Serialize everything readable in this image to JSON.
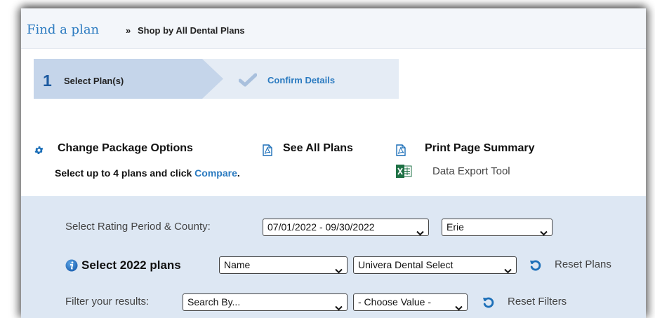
{
  "breadcrumb": {
    "link": "Find a plan",
    "separator": "»",
    "current": "Shop by All Dental Plans"
  },
  "steps": {
    "step1_number": "1",
    "step1_label": "Select Plan(s)",
    "step2_label": "Confirm Details"
  },
  "actions": {
    "change_package": "Change Package Options",
    "see_all_plans": "See All Plans",
    "print_summary": "Print Page Summary",
    "select_text": "Select up to 4 plans and click ",
    "compare": "Compare",
    "period": ".",
    "data_export": "Data Export Tool"
  },
  "filters": {
    "rating_label": "Select Rating Period & County:",
    "rating_period": "07/01/2022 - 09/30/2022",
    "county": "Erie",
    "plans_label": "Select 2022 plans",
    "plan_field": "Name",
    "plan_value": "Univera Dental Select",
    "reset_plans": "Reset Plans",
    "filter_label": "Filter your results:",
    "search_by": "Search By...",
    "choose_value": "- Choose Value -",
    "reset_filters": "Reset Filters"
  },
  "colors": {
    "link_blue": "#2a7ac0",
    "step_active": "#c5d5ea",
    "step_inactive": "#e5ecf5",
    "panel": "#dde7f3"
  }
}
